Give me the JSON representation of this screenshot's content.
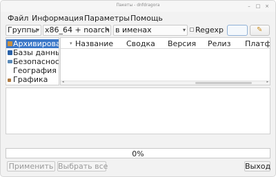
{
  "window": {
    "title": "Пакеты - dnfdragora"
  },
  "menu": [
    "Файл",
    "Информация",
    "Параметры",
    "Помощь"
  ],
  "filters": {
    "group_select": "Группы",
    "arch_select": "x86_64 + noarch",
    "search_field_select": "в именах",
    "regexp_label": "Regexp"
  },
  "groups": [
    {
      "label": "Архивирование",
      "selected": true,
      "icon_color": "#c89040"
    },
    {
      "label": "Базы данных",
      "selected": false,
      "icon_color": "#2a62a8"
    },
    {
      "label": "Безопасность",
      "selected": false,
      "icon_color": "#5a8ab8"
    },
    {
      "label": "География",
      "selected": false,
      "icon_color": ""
    },
    {
      "label": "Графика",
      "selected": false,
      "icon_color": "#b07a40"
    }
  ],
  "table": {
    "columns": [
      "Название",
      "Сводка",
      "Версия",
      "Релиз",
      "Платформа"
    ]
  },
  "progress": {
    "text": "0%",
    "value": 0
  },
  "buttons": {
    "apply": "Применить",
    "select_all": "Выбрать все",
    "quit": "Выход"
  },
  "icons": {
    "window_minimize": "minimize-icon",
    "window_maximize": "maximize-icon",
    "window_close": "close-icon",
    "edit": "pencil-icon"
  }
}
